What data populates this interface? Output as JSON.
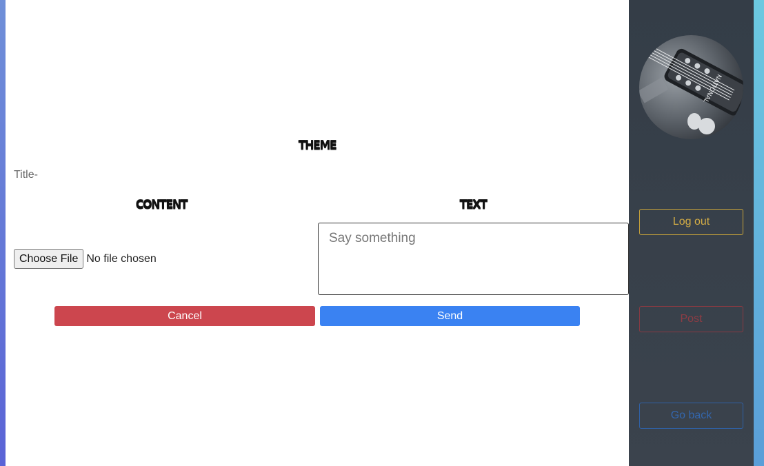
{
  "form": {
    "theme_heading": "THEME",
    "title_label": "Title-",
    "content_heading": "CONTENT",
    "text_heading": "TEXT",
    "file_button_label": "Choose File",
    "file_status": "No file chosen",
    "textarea_placeholder": "Say something",
    "cancel_label": "Cancel",
    "send_label": "Send"
  },
  "sidebar": {
    "avatar_icon": "guitar-headstock-avatar",
    "avatar_text": "NATIONAL",
    "logout_label": "Log out",
    "post_label": "Post",
    "goback_label": "Go back"
  },
  "colors": {
    "cancel": "#cc464e",
    "send": "#3a82f2",
    "sidebar": "#343d47",
    "logout": "#d4ad45",
    "post": "#8e3c44",
    "goback": "#3366ad"
  }
}
